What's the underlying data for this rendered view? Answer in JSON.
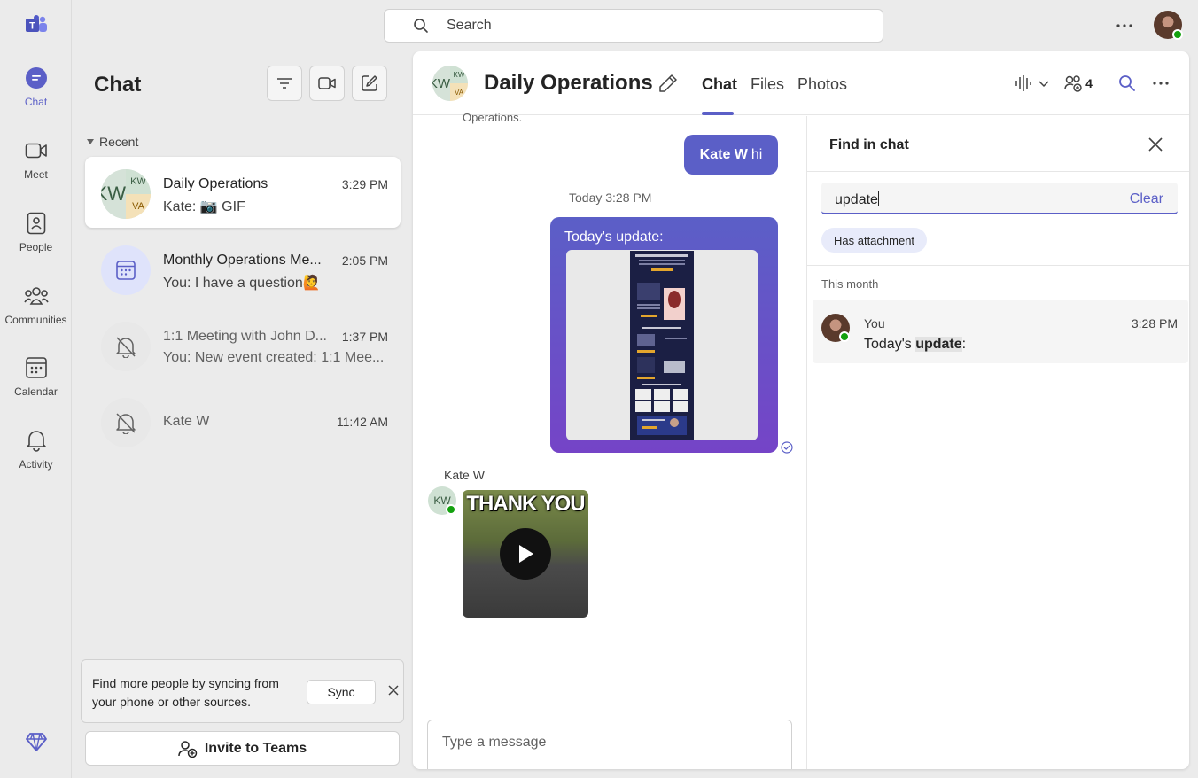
{
  "top": {
    "search_placeholder": "Search"
  },
  "rail": {
    "items": [
      {
        "label": "Chat",
        "icon": "chat-icon",
        "active": true
      },
      {
        "label": "Meet",
        "icon": "video-icon"
      },
      {
        "label": "People",
        "icon": "people-icon"
      },
      {
        "label": "Communities",
        "icon": "communities-icon"
      },
      {
        "label": "Calendar",
        "icon": "calendar-icon"
      },
      {
        "label": "Activity",
        "icon": "bell-icon"
      }
    ]
  },
  "chat_list": {
    "title": "Chat",
    "section": "Recent",
    "items": [
      {
        "name": "Daily Operations",
        "time": "3:29 PM",
        "preview": "Kate: 📷 GIF",
        "selected": true,
        "avatar": {
          "a": "KW",
          "b": "KW",
          "c": "VA"
        }
      },
      {
        "name": "Monthly Operations Me...",
        "time": "2:05 PM",
        "preview": "You: I have a question🙋"
      },
      {
        "name": "1:1 Meeting with John D...",
        "time": "1:37 PM",
        "preview": "You: New event created: 1:1 Mee..."
      },
      {
        "name": "Kate W",
        "time": "11:42 AM",
        "preview": ""
      }
    ],
    "sync_card": {
      "text": "Find more people by syncing from your phone or other sources.",
      "button": "Sync"
    },
    "invite_label": "Invite to Teams"
  },
  "conversation": {
    "title": "Daily Operations",
    "avatar": {
      "a": "KW",
      "b": "KW",
      "c": "VA"
    },
    "tabs": [
      "Chat",
      "Files",
      "Photos"
    ],
    "participants_count": "4",
    "clipped_sender": "Operations.",
    "messages": {
      "mention_name": "Kate W",
      "mention_text": "hi",
      "timestamp": "Today 3:28 PM",
      "update_caption": "Today's update:",
      "sender": "Kate W",
      "sender_initials": "KW",
      "gif_text": "THANK YOU"
    },
    "compose_placeholder": "Type a message"
  },
  "find": {
    "title": "Find in chat",
    "query": "update",
    "clear_label": "Clear",
    "filter_chip": "Has attachment",
    "group_label": "This month",
    "result": {
      "name": "You",
      "time": "3:28 PM",
      "pre": "Today's ",
      "match": "update",
      "post": ":"
    }
  },
  "colors": {
    "accent": "#5b5fc7",
    "presence": "#13a10e"
  }
}
